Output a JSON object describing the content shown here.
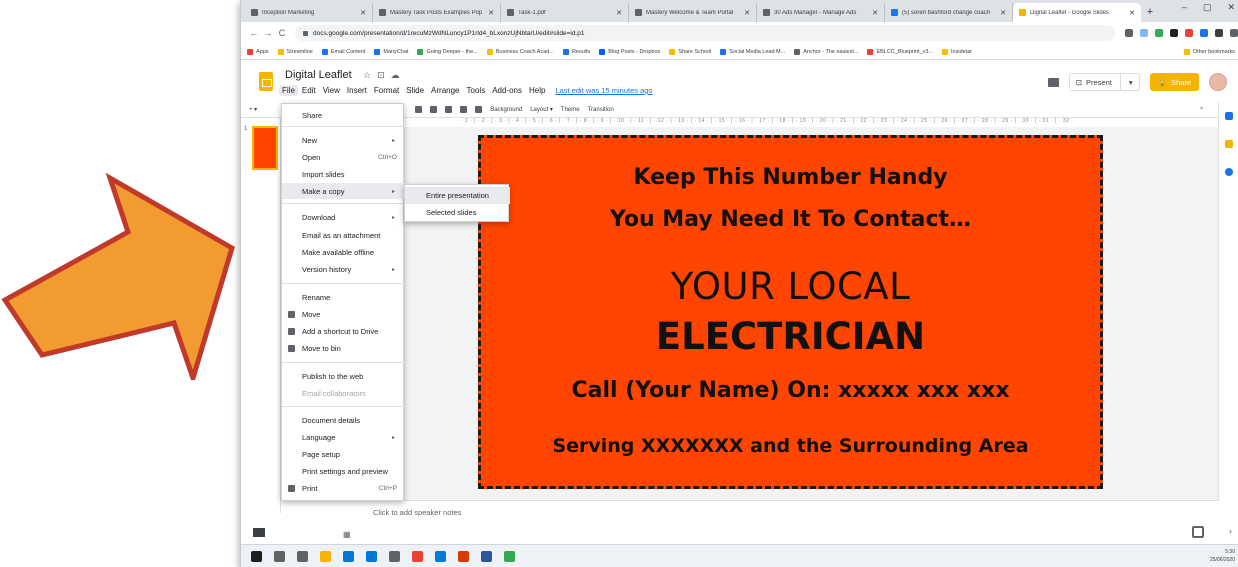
{
  "browser": {
    "tabs": [
      {
        "label": "Inception Marketing",
        "color": "#5f6368"
      },
      {
        "label": "Mastery Task Posts Examples Pop",
        "color": "#5f6368"
      },
      {
        "label": "Task-1.pdf",
        "color": "#5f6368"
      },
      {
        "label": "Mastery Welcome & Team Portal",
        "color": "#5f6368"
      },
      {
        "label": "30 Ads Manager - Manage Ads",
        "color": "#5f6368"
      },
      {
        "label": "(5) soren bashford change coach",
        "color": "#1877f2"
      },
      {
        "label": "Digital Leaflet - Google Slides",
        "color": "#f4b400"
      }
    ],
    "new_tab": "+",
    "window_controls": {
      "minimize": "–",
      "restore": "▢",
      "close": "✕"
    },
    "url": "docs.google.com/presentation/d/1recuMzWdNLuncy1P1rld4_bLxonzUjNbtarU/edit#slide=id.p1",
    "nav": {
      "back": "←",
      "forward": "→",
      "reload": "C"
    },
    "extension_colors": [
      "#5f6368",
      "#8ab4f8",
      "#34a853",
      "#202124",
      "#ea4335",
      "#1a73e8",
      "#3c4043",
      "#5f6368"
    ],
    "bookmarks": [
      {
        "label": "Apps",
        "color": "#ea4335"
      },
      {
        "label": "Streamline",
        "color": "#fbbc04"
      },
      {
        "label": "Email Content",
        "color": "#1a73e8"
      },
      {
        "label": "ManyChat",
        "color": "#1a73e8"
      },
      {
        "label": "Going Deeper - the...",
        "color": "#34a853"
      },
      {
        "label": "Business Coach Acad...",
        "color": "#fbbc04"
      },
      {
        "label": "Results",
        "color": "#1a73e8"
      },
      {
        "label": "Blog Posts - Dropbox",
        "color": "#0061ff"
      },
      {
        "label": "Share School",
        "color": "#fbbc04"
      },
      {
        "label": "Social Media Lead M...",
        "color": "#1a73e8"
      },
      {
        "label": "Anchor - The easiest...",
        "color": "#5f6368"
      },
      {
        "label": "EBLCC_Blueprint_v3...",
        "color": "#ea4335"
      },
      {
        "label": "Insidetar",
        "color": "#fbbc04"
      }
    ],
    "other_bookmarks": "Other bookmarks"
  },
  "docs": {
    "title": "Digital Leaflet",
    "title_icons": [
      "☆",
      "⊡",
      "☁"
    ],
    "menus": [
      "File",
      "Edit",
      "View",
      "Insert",
      "Format",
      "Slide",
      "Arrange",
      "Tools",
      "Add-ons",
      "Help"
    ],
    "last_edit": "Last edit was 15 minutes ago",
    "present_label": "Present",
    "present_caret": "▾",
    "share_label": "Share",
    "toolbar": {
      "background": "Background",
      "layout": "Layout ▾",
      "theme": "Theme",
      "transition": "Transition"
    },
    "ruler": "· 1 · | · 2 · | · 3 · | · 4 · | · 5 · | · 6 · | · 7 · | · 8 · | · 9 · | · 10 · | · 11 · | · 12 · | · 13 · | · 14 · | · 15 · | · 16 · | · 17 · | · 18 · | · 19 · | · 20 · | · 21 · | · 22 · | · 23 · | · 24 · | · 25 · | · 26 · | · 27 · | · 28 · | · 29 · | · 30 · | · 31 · | · 32 ·",
    "slide_number": "1",
    "speaker_notes_placeholder": "Click to add speaker notes"
  },
  "slide": {
    "bg_color": "#ff4500",
    "line1": "Keep This Number Handy",
    "line2": "You May Need It To Contact…",
    "line3": "YOUR LOCAL",
    "line4": "ELECTRICIAN",
    "line5": "Call (Your Name) On: xxxxx xxx xxx",
    "line6": "Serving XXXXXXX and the Surrounding Area"
  },
  "file_menu": {
    "items": [
      {
        "label": "Share",
        "shortcut": "",
        "submenu": false,
        "icon": false
      },
      {
        "label": "New",
        "shortcut": "",
        "submenu": true,
        "icon": false
      },
      {
        "label": "Open",
        "shortcut": "Ctrl+O",
        "submenu": false,
        "icon": false
      },
      {
        "label": "Import slides",
        "shortcut": "",
        "submenu": false,
        "icon": false
      },
      {
        "label": "Make a copy",
        "shortcut": "",
        "submenu": true,
        "icon": false
      },
      {
        "label": "Download",
        "shortcut": "",
        "submenu": true,
        "icon": false
      },
      {
        "label": "Email as an attachment",
        "shortcut": "",
        "submenu": false,
        "icon": false
      },
      {
        "label": "Make available offline",
        "shortcut": "",
        "submenu": false,
        "icon": false
      },
      {
        "label": "Version history",
        "shortcut": "",
        "submenu": true,
        "icon": false
      },
      {
        "label": "Rename",
        "shortcut": "",
        "submenu": false,
        "icon": false
      },
      {
        "label": "Move",
        "shortcut": "",
        "submenu": false,
        "icon": true
      },
      {
        "label": "Add a shortcut to Drive",
        "shortcut": "",
        "submenu": false,
        "icon": true
      },
      {
        "label": "Move to bin",
        "shortcut": "",
        "submenu": false,
        "icon": true
      },
      {
        "label": "Publish to the web",
        "shortcut": "",
        "submenu": false,
        "icon": false
      },
      {
        "label": "Email collaborators",
        "shortcut": "",
        "submenu": false,
        "icon": false
      },
      {
        "label": "Document details",
        "shortcut": "",
        "submenu": false,
        "icon": false
      },
      {
        "label": "Language",
        "shortcut": "",
        "submenu": true,
        "icon": false
      },
      {
        "label": "Page setup",
        "shortcut": "",
        "submenu": false,
        "icon": false
      },
      {
        "label": "Print settings and preview",
        "shortcut": "",
        "submenu": false,
        "icon": false
      },
      {
        "label": "Print",
        "shortcut": "Ctrl+P",
        "submenu": false,
        "icon": true
      }
    ],
    "submenu_arrow": "▸"
  },
  "copy_submenu": {
    "items": [
      "Entire presentation",
      "Selected slides"
    ]
  },
  "taskbar": {
    "time": "5:30",
    "date": "25/06/2020",
    "app_colors": [
      "#1e1e1e",
      "#5f6368",
      "#5f6368",
      "#f4b400",
      "#0078d4",
      "#0078d4",
      "#5f6368",
      "#ea4335",
      "#0078d4",
      "#d83b01",
      "#2b579a",
      "#34a853"
    ]
  },
  "arrow_color": "#f29b30",
  "arrow_outline": "#c0392b"
}
